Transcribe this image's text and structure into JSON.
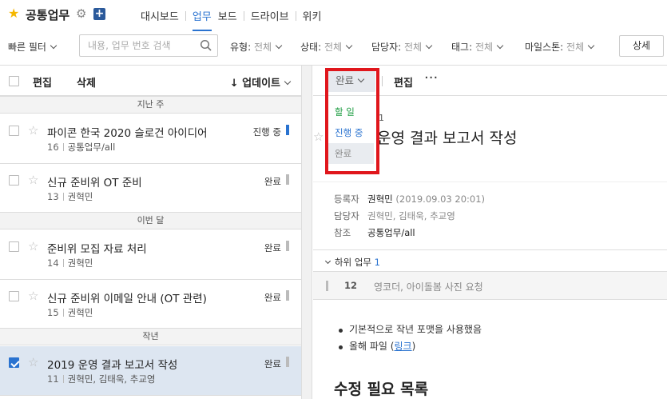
{
  "header": {
    "project_title": "공통업무",
    "nav": [
      "대시보드",
      "업무",
      "보드",
      "드라이브",
      "위키"
    ],
    "active_nav": "업무"
  },
  "filters": {
    "fast_filter": "빠른 필터",
    "search_placeholder": "내용, 업무 번호 검색",
    "type_label": "유형:",
    "type_value": "전체",
    "status_label": "상태:",
    "status_value": "전체",
    "assignee_label": "담당자:",
    "assignee_value": "전체",
    "tag_label": "태그:",
    "tag_value": "전체",
    "milestone_label": "마일스톤:",
    "milestone_value": "전체",
    "detail_button": "상세"
  },
  "list": {
    "edit": "편집",
    "delete": "삭제",
    "sort": "↓ 업데이트",
    "groups": [
      {
        "label": "지난 주"
      },
      {
        "label": "이번 달"
      },
      {
        "label": "작년"
      }
    ],
    "tasks": [
      {
        "title": "파이콘 한국 2020 슬로건 아이디어",
        "num": "16",
        "meta": "공통업무/all",
        "status": "진행 중",
        "status_color": "#2a73d0"
      },
      {
        "title": "신규 준비위 OT 준비",
        "num": "13",
        "meta": "권혁민",
        "status": "완료",
        "status_color": "#bbbbbb"
      },
      {
        "title": "준비위 모집 자료 처리",
        "num": "14",
        "meta": "권혁민",
        "status": "완료",
        "status_color": "#bbbbbb"
      },
      {
        "title": "신규 준비위 이메일 안내 (OT 관련)",
        "num": "15",
        "meta": "권혁민",
        "status": "완료",
        "status_color": "#bbbbbb"
      },
      {
        "title": "2019 운영 결과 보고서 작성",
        "num": "11",
        "meta": "권혁민, 김태욱, 추교영",
        "status": "완료",
        "status_color": "#bbbbbb",
        "selected": true
      }
    ]
  },
  "detail": {
    "status_dropdown": "완료",
    "edit": "편집",
    "status_options": [
      "할 일",
      "진행 중",
      "완료"
    ],
    "task_number": "1",
    "title": "운영 결과 보고서 작성",
    "props": {
      "reporter_label": "등록자",
      "reporter_name": "권혁민",
      "reporter_time": "(2019.09.03 20:01)",
      "assignee_label": "담당자",
      "assignee_value": "권혁민, 김태욱, 추교영",
      "ref_label": "참조",
      "ref_value": "공통업무/all"
    },
    "subtasks": {
      "label": "하위 업무",
      "count": "1",
      "items": [
        {
          "num": "12",
          "title": "영코더, 아이돌봄 사진 요청"
        }
      ]
    },
    "bullets": {
      "item1": "기본적으로 작년 포맷을 사용했음",
      "item2_prefix": "올해 파일 (",
      "item2_link": "링크",
      "item2_suffix": ")"
    },
    "section_title": "수정 필요 목록"
  },
  "colors": {
    "accent": "#2a73d0",
    "highlight": "#e0161c",
    "todo": "#1f9d43",
    "star": "#f5b700"
  }
}
